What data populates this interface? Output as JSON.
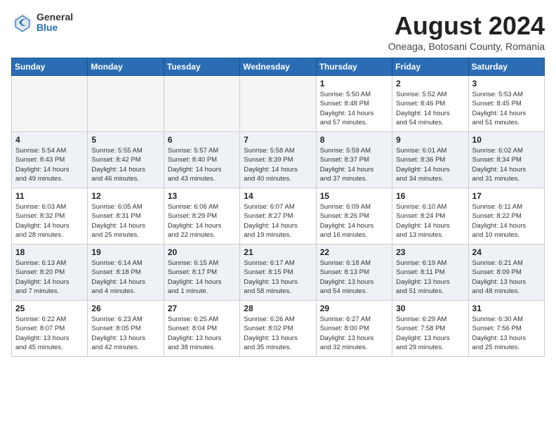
{
  "header": {
    "logo_general": "General",
    "logo_blue": "Blue",
    "month_title": "August 2024",
    "subtitle": "Oneaga, Botosani County, Romania"
  },
  "weekdays": [
    "Sunday",
    "Monday",
    "Tuesday",
    "Wednesday",
    "Thursday",
    "Friday",
    "Saturday"
  ],
  "weeks": [
    {
      "alt": false,
      "days": [
        {
          "num": "",
          "text": "",
          "empty": true
        },
        {
          "num": "",
          "text": "",
          "empty": true
        },
        {
          "num": "",
          "text": "",
          "empty": true
        },
        {
          "num": "",
          "text": "",
          "empty": true
        },
        {
          "num": "1",
          "text": "Sunrise: 5:50 AM\nSunset: 8:48 PM\nDaylight: 14 hours\nand 57 minutes."
        },
        {
          "num": "2",
          "text": "Sunrise: 5:52 AM\nSunset: 8:46 PM\nDaylight: 14 hours\nand 54 minutes."
        },
        {
          "num": "3",
          "text": "Sunrise: 5:53 AM\nSunset: 8:45 PM\nDaylight: 14 hours\nand 51 minutes."
        }
      ]
    },
    {
      "alt": true,
      "days": [
        {
          "num": "4",
          "text": "Sunrise: 5:54 AM\nSunset: 8:43 PM\nDaylight: 14 hours\nand 49 minutes."
        },
        {
          "num": "5",
          "text": "Sunrise: 5:55 AM\nSunset: 8:42 PM\nDaylight: 14 hours\nand 46 minutes."
        },
        {
          "num": "6",
          "text": "Sunrise: 5:57 AM\nSunset: 8:40 PM\nDaylight: 14 hours\nand 43 minutes."
        },
        {
          "num": "7",
          "text": "Sunrise: 5:58 AM\nSunset: 8:39 PM\nDaylight: 14 hours\nand 40 minutes."
        },
        {
          "num": "8",
          "text": "Sunrise: 5:59 AM\nSunset: 8:37 PM\nDaylight: 14 hours\nand 37 minutes."
        },
        {
          "num": "9",
          "text": "Sunrise: 6:01 AM\nSunset: 8:36 PM\nDaylight: 14 hours\nand 34 minutes."
        },
        {
          "num": "10",
          "text": "Sunrise: 6:02 AM\nSunset: 8:34 PM\nDaylight: 14 hours\nand 31 minutes."
        }
      ]
    },
    {
      "alt": false,
      "days": [
        {
          "num": "11",
          "text": "Sunrise: 6:03 AM\nSunset: 8:32 PM\nDaylight: 14 hours\nand 28 minutes."
        },
        {
          "num": "12",
          "text": "Sunrise: 6:05 AM\nSunset: 8:31 PM\nDaylight: 14 hours\nand 25 minutes."
        },
        {
          "num": "13",
          "text": "Sunrise: 6:06 AM\nSunset: 8:29 PM\nDaylight: 14 hours\nand 22 minutes."
        },
        {
          "num": "14",
          "text": "Sunrise: 6:07 AM\nSunset: 8:27 PM\nDaylight: 14 hours\nand 19 minutes."
        },
        {
          "num": "15",
          "text": "Sunrise: 6:09 AM\nSunset: 8:26 PM\nDaylight: 14 hours\nand 16 minutes."
        },
        {
          "num": "16",
          "text": "Sunrise: 6:10 AM\nSunset: 8:24 PM\nDaylight: 14 hours\nand 13 minutes."
        },
        {
          "num": "17",
          "text": "Sunrise: 6:11 AM\nSunset: 8:22 PM\nDaylight: 14 hours\nand 10 minutes."
        }
      ]
    },
    {
      "alt": true,
      "days": [
        {
          "num": "18",
          "text": "Sunrise: 6:13 AM\nSunset: 8:20 PM\nDaylight: 14 hours\nand 7 minutes."
        },
        {
          "num": "19",
          "text": "Sunrise: 6:14 AM\nSunset: 8:18 PM\nDaylight: 14 hours\nand 4 minutes."
        },
        {
          "num": "20",
          "text": "Sunrise: 6:15 AM\nSunset: 8:17 PM\nDaylight: 14 hours\nand 1 minute."
        },
        {
          "num": "21",
          "text": "Sunrise: 6:17 AM\nSunset: 8:15 PM\nDaylight: 13 hours\nand 58 minutes."
        },
        {
          "num": "22",
          "text": "Sunrise: 6:18 AM\nSunset: 8:13 PM\nDaylight: 13 hours\nand 54 minutes."
        },
        {
          "num": "23",
          "text": "Sunrise: 6:19 AM\nSunset: 8:11 PM\nDaylight: 13 hours\nand 51 minutes."
        },
        {
          "num": "24",
          "text": "Sunrise: 6:21 AM\nSunset: 8:09 PM\nDaylight: 13 hours\nand 48 minutes."
        }
      ]
    },
    {
      "alt": false,
      "days": [
        {
          "num": "25",
          "text": "Sunrise: 6:22 AM\nSunset: 8:07 PM\nDaylight: 13 hours\nand 45 minutes."
        },
        {
          "num": "26",
          "text": "Sunrise: 6:23 AM\nSunset: 8:05 PM\nDaylight: 13 hours\nand 42 minutes."
        },
        {
          "num": "27",
          "text": "Sunrise: 6:25 AM\nSunset: 8:04 PM\nDaylight: 13 hours\nand 38 minutes."
        },
        {
          "num": "28",
          "text": "Sunrise: 6:26 AM\nSunset: 8:02 PM\nDaylight: 13 hours\nand 35 minutes."
        },
        {
          "num": "29",
          "text": "Sunrise: 6:27 AM\nSunset: 8:00 PM\nDaylight: 13 hours\nand 32 minutes."
        },
        {
          "num": "30",
          "text": "Sunrise: 6:29 AM\nSunset: 7:58 PM\nDaylight: 13 hours\nand 29 minutes."
        },
        {
          "num": "31",
          "text": "Sunrise: 6:30 AM\nSunset: 7:56 PM\nDaylight: 13 hours\nand 25 minutes."
        }
      ]
    }
  ]
}
